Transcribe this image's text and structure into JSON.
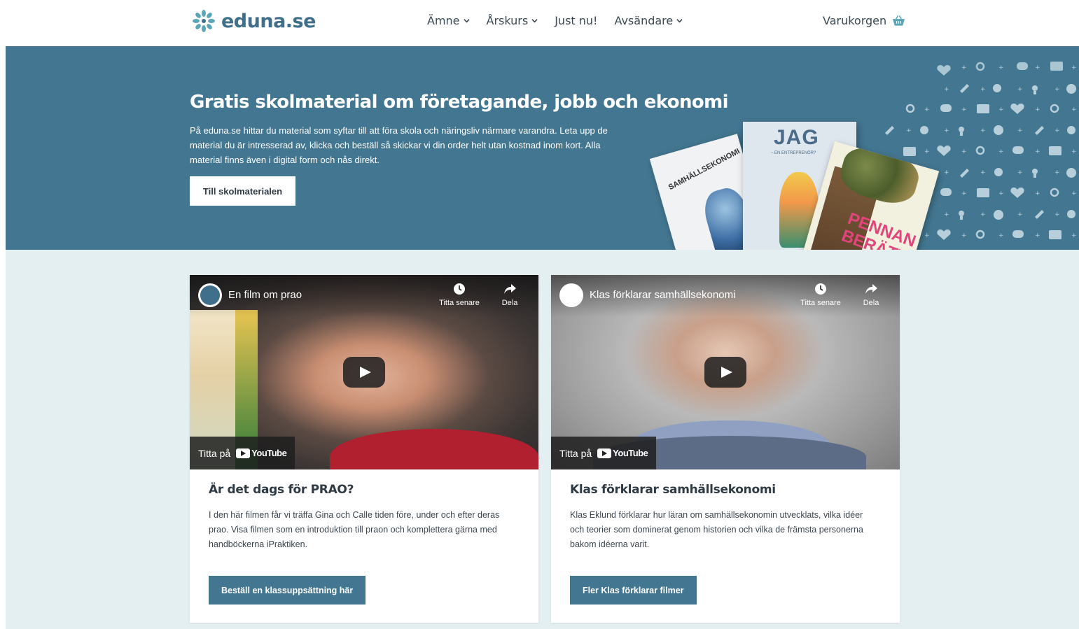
{
  "header": {
    "logo_text": "eduna.se",
    "nav": [
      {
        "label": "Ämne",
        "has_dropdown": true
      },
      {
        "label": "Årskurs",
        "has_dropdown": true
      },
      {
        "label": "Just nu!",
        "has_dropdown": false
      },
      {
        "label": "Avsändare",
        "has_dropdown": true
      }
    ],
    "cart_label": "Varukorgen"
  },
  "hero": {
    "title": "Gratis skolmaterial om företagande, jobb och ekonomi",
    "text": "På eduna.se hittar du material som syftar till att föra skola och näringsliv närmare varandra. Leta upp de material du är intresserad av, klicka och beställ så skickar vi din order helt utan kostnad inom kort. Alla material finns även i digital form och nås direkt.",
    "button": "Till skolmaterialen",
    "books": [
      {
        "title": "SAMHÄLLSEKONOMI"
      },
      {
        "title": "JAG",
        "subtitle": "– EN ENTREPRENÖR?"
      },
      {
        "title": "PENNAN BERÄTTAR"
      }
    ],
    "pattern_icons": [
      "heart-icon",
      "search-icon",
      "chat-icon",
      "book-icon",
      "pencil-icon",
      "flower-icon",
      "bulb-icon",
      "play-icon"
    ]
  },
  "cards": [
    {
      "video": {
        "title": "En film om prao",
        "watch_later": "Titta senare",
        "share": "Dela",
        "watch_on": "Titta på",
        "platform": "YouTube"
      },
      "title": "Är det dags för PRAO?",
      "text": "I den här filmen får vi träffa Gina och Calle tiden före, under och efter deras prao. Visa filmen som en introduktion till praon och komplettera gärna med handböckerna iPraktiken.",
      "button": "Beställ en klassuppsättning här"
    },
    {
      "video": {
        "title": "Klas förklarar samhällsekonomi",
        "watch_later": "Titta senare",
        "share": "Dela",
        "watch_on": "Titta på",
        "platform": "YouTube"
      },
      "title": "Klas förklarar samhällsekonomi",
      "text": "Klas Eklund förklarar hur läran om samhällsekonomin utvecklats, vilka idéer och teorier som dominerat genom historien och vilka de främsta personerna bakom idéerna varit.",
      "button": "Fler Klas förklarar filmer"
    }
  ],
  "colors": {
    "brand": "#437690",
    "content_bg": "#e4eff1",
    "text_dark": "#2f3b44"
  }
}
